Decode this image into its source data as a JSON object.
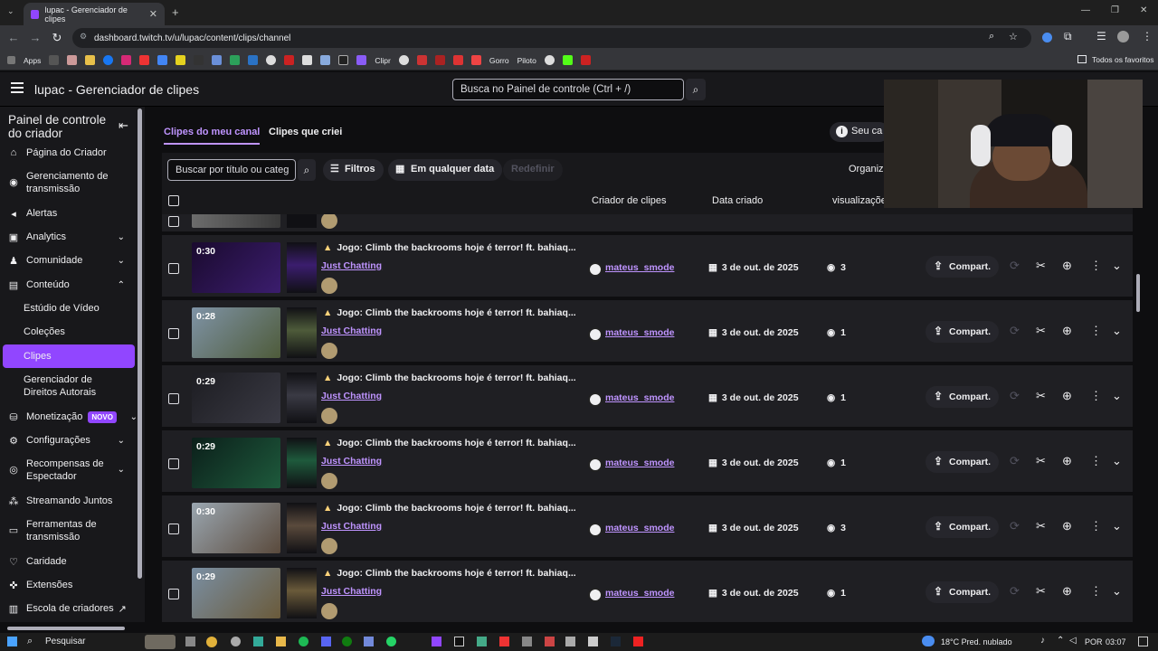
{
  "browser": {
    "tab_title": "lupac - Gerenciador de clipes",
    "url": "dashboard.twitch.tv/u/lupac/content/clips/channel",
    "bookmarks": [
      "Apps",
      "Clipr",
      "Gorro",
      "Piloto"
    ],
    "bookmarks_right": "Todos os favoritos"
  },
  "header": {
    "title": "lupac - Gerenciador de clipes",
    "search_placeholder": "Busca no Painel de controle (Ctrl + /)"
  },
  "sidebar": {
    "title": "Painel de controle do criador",
    "items": [
      {
        "label": "Página do Criador",
        "icon": "home-icon"
      },
      {
        "label": "Gerenciamento de transmissão",
        "icon": "broadcast-icon"
      },
      {
        "label": "Alertas",
        "icon": "megaphone-icon"
      },
      {
        "label": "Analytics",
        "icon": "analytics-icon"
      },
      {
        "label": "Comunidade",
        "icon": "community-icon"
      },
      {
        "label": "Conteúdo",
        "icon": "content-icon"
      },
      {
        "label": "Monetização",
        "icon": "money-icon",
        "badge": "NOVO"
      },
      {
        "label": "Configurações",
        "icon": "gear-icon"
      },
      {
        "label": "Recompensas de Espectador",
        "icon": "rewards-icon"
      },
      {
        "label": "Streamando Juntos",
        "icon": "together-icon"
      },
      {
        "label": "Ferramentas de transmissão",
        "icon": "camera-icon"
      },
      {
        "label": "Caridade",
        "icon": "heart-icon"
      },
      {
        "label": "Extensões",
        "icon": "puzzle-icon"
      },
      {
        "label": "Escola de criadores",
        "icon": "school-icon"
      }
    ],
    "content_sub": [
      "Estúdio de Vídeo",
      "Coleções",
      "Clipes",
      "Gerenciador de Direitos Autorais"
    ]
  },
  "main": {
    "tabs": [
      "Clipes do meu canal",
      "Clipes que criei"
    ],
    "info_button": "Seu ca",
    "clip_search_placeholder": "Buscar por título ou categ",
    "filters_label": "Filtros",
    "date_label": "Em qualquer data",
    "reset_label": "Redefinir",
    "organize_label": "Organiz",
    "columns": {
      "creator": "Criador de clipes",
      "date": "Data criado",
      "views": "visualizaçõe"
    },
    "share_label": "Compart.",
    "rows": [
      {
        "duration": "0:30",
        "title": "Jogo: Climb the backrooms hoje é terror! ft. bahiaq...",
        "category": "Just Chatting",
        "creator": "mateus_smode",
        "date": "3 de out. de 2025",
        "views": "3",
        "thumb": [
          "#1a0a2e",
          "#3b1d6e"
        ]
      },
      {
        "duration": "0:28",
        "title": "Jogo: Climb the backrooms hoje é terror! ft. bahiaq...",
        "category": "Just Chatting",
        "creator": "mateus_smode",
        "date": "3 de out. de 2025",
        "views": "1",
        "thumb": [
          "#7f93a6",
          "#4e5b3a"
        ]
      },
      {
        "duration": "0:29",
        "title": "Jogo: Climb the backrooms hoje é terror! ft. bahiaq...",
        "category": "Just Chatting",
        "creator": "mateus_smode",
        "date": "3 de out. de 2025",
        "views": "1",
        "thumb": [
          "#1d1d22",
          "#3a3a44"
        ]
      },
      {
        "duration": "0:29",
        "title": "Jogo: Climb the backrooms hoje é terror! ft. bahiaq...",
        "category": "Just Chatting",
        "creator": "mateus_smode",
        "date": "3 de out. de 2025",
        "views": "1",
        "thumb": [
          "#0b1f1a",
          "#1e5a3c"
        ]
      },
      {
        "duration": "0:30",
        "title": "Jogo: Climb the backrooms hoje é terror! ft. bahiaq...",
        "category": "Just Chatting",
        "creator": "mateus_smode",
        "date": "3 de out. de 2025",
        "views": "3",
        "thumb": [
          "#9aa6b0",
          "#5a4a3c"
        ]
      },
      {
        "duration": "0:29",
        "title": "Jogo: Climb the backrooms hoje é terror! ft. bahiaq...",
        "category": "Just Chatting",
        "creator": "mateus_smode",
        "date": "3 de out. de 2025",
        "views": "1",
        "thumb": [
          "#7a8fa3",
          "#6a5a3a"
        ]
      }
    ]
  },
  "taskbar": {
    "search": "Pesquisar",
    "weather": "18°C  Pred. nublado",
    "lang": "POR",
    "time": "03:07"
  },
  "colors": {
    "accent": "#9146ff",
    "link": "#bf94ff"
  }
}
